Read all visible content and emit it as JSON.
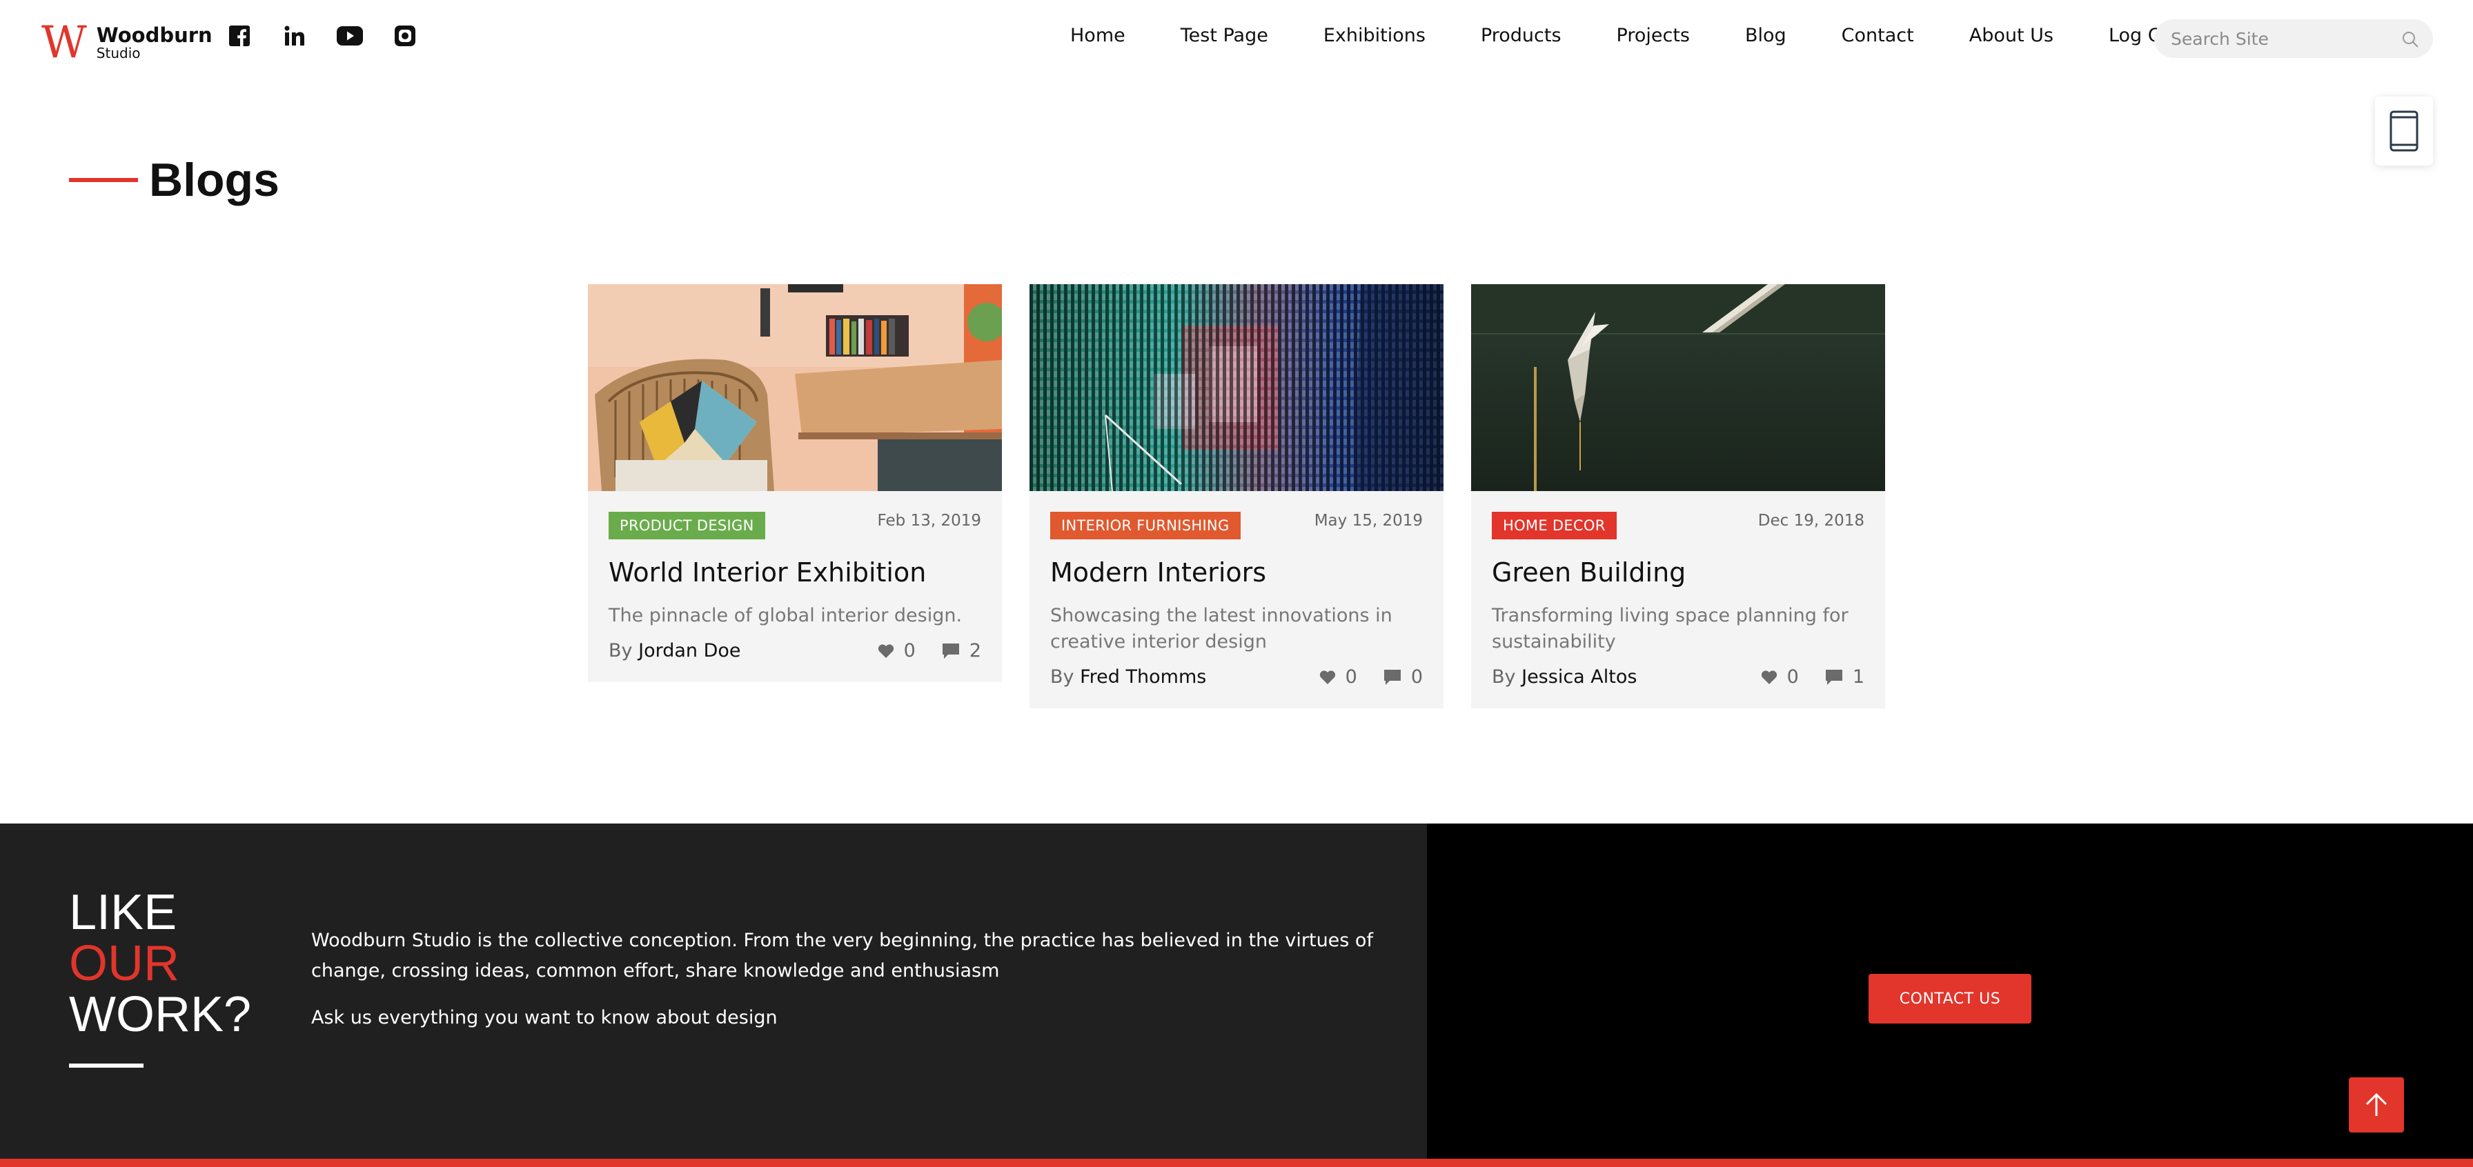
{
  "brand": {
    "logo_letter": "W",
    "name": "Woodburn",
    "sub": "Studio",
    "accent_color": "#e2352b"
  },
  "socials": [
    {
      "icon": "facebook-icon"
    },
    {
      "icon": "linkedin-icon"
    },
    {
      "icon": "youtube-icon"
    },
    {
      "icon": "instagram-icon"
    }
  ],
  "nav": {
    "items": [
      "Home",
      "Test Page",
      "Exhibitions",
      "Products",
      "Projects",
      "Blog",
      "Contact",
      "About Us",
      "Log Out"
    ]
  },
  "search": {
    "placeholder": "Search Site"
  },
  "page": {
    "title": "Blogs"
  },
  "posts": [
    {
      "category": "PRODUCT DESIGN",
      "category_color": "#6aac4c",
      "date": "Feb 13, 2019",
      "title": "World Interior Exhibition",
      "excerpt": "The pinnacle of global interior design.",
      "by": "By",
      "author": "Jordan Doe",
      "likes": "0",
      "comments": "2"
    },
    {
      "category": "INTERIOR FURNISHING",
      "category_color": "#e0592f",
      "date": "May 15, 2019",
      "title": "Modern Interiors",
      "excerpt": "Showcasing the latest innovations in creative interior design",
      "by": "By",
      "author": "Fred Thomms",
      "likes": "0",
      "comments": "0"
    },
    {
      "category": "HOME DECOR",
      "category_color": "#e2352b",
      "date": "Dec 19, 2018",
      "title": "Green Building",
      "excerpt": "Transforming living space planning for sustainability",
      "by": "By",
      "author": "Jessica Altos",
      "likes": "0",
      "comments": "1"
    }
  ],
  "cta": {
    "line1": "LIKE",
    "line2": "OUR",
    "line3": "WORK?",
    "text": "Woodburn Studio is the collective conception. From the very beginning, the practice has believed in the virtues of change, crossing ideas, common effort, share knowledge and enthusiasm",
    "text2": "Ask us everything you want to know about design",
    "button": "CONTACT US"
  }
}
